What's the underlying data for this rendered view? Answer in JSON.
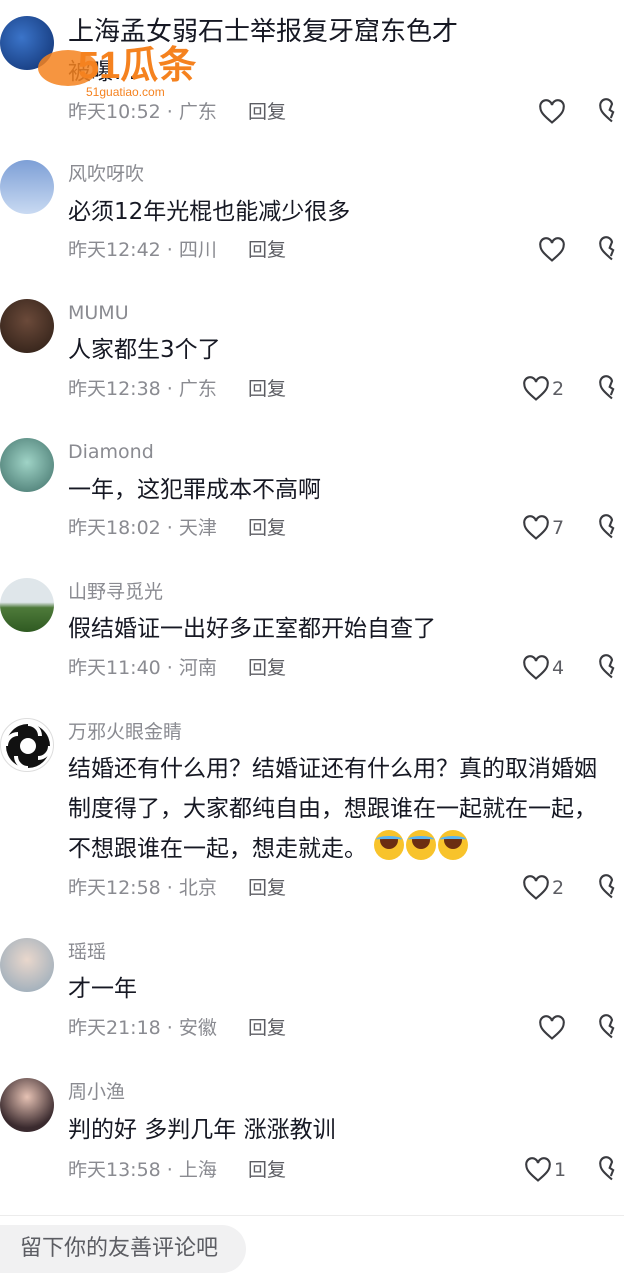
{
  "comments": [
    {
      "username": "",
      "text": "上海孟女弱石士举报复牙窟东色才",
      "text2": "被曝...",
      "meta": "昨天10:52 · 广东",
      "reply": "回复",
      "likes": "",
      "avatar": "blue-avatar"
    },
    {
      "username": "风吹呀吹",
      "text": "必须12年光棍也能减少很多",
      "meta": "昨天12:42 · 四川",
      "reply": "回复",
      "likes": "",
      "avatar": "sky-avatar"
    },
    {
      "username": "MUMU",
      "text": "人家都生3个了",
      "meta": "昨天12:38 · 广东",
      "reply": "回复",
      "likes": "2",
      "avatar": "dark-photo-avatar"
    },
    {
      "username": "Diamond",
      "text": "一年，这犯罪成本不高啊",
      "meta": "昨天18:02 · 天津",
      "reply": "回复",
      "likes": "7",
      "avatar": "anime-avatar"
    },
    {
      "username": "山野寻觅光",
      "text": "假结婚证一出好多正室都开始自查了",
      "meta": "昨天11:40 · 河南",
      "reply": "回复",
      "likes": "4",
      "avatar": "landscape-avatar"
    },
    {
      "username": "万邪火眼金睛",
      "text": "结婚还有什么用？结婚证还有什么用？真的取消婚姻",
      "text2": "制度得了，大家都纯自由，想跟谁在一起就在一起，",
      "text3": "不想跟谁在一起，想走就走。",
      "meta": "昨天12:58 · 北京",
      "reply": "回复",
      "likes": "2",
      "avatar": "swirl-avatar"
    },
    {
      "username": "瑶瑶",
      "text": "才一年",
      "meta": "昨天21:18 · 安徽",
      "reply": "回复",
      "likes": "",
      "avatar": "girl-avatar"
    },
    {
      "username": "周小渔",
      "text": "判的好 多判几年 涨涨教训",
      "meta": "昨天13:58 · 上海",
      "reply": "回复",
      "likes": "1",
      "avatar": "woman-avatar"
    }
  ],
  "emojis": [
    "laugh-cry-emoji",
    "laugh-cry-emoji",
    "laugh-cry-emoji"
  ],
  "input": {
    "placeholder": "留下你的友善评论吧"
  },
  "watermark": {
    "brand": "51瓜条",
    "url": "51guatiao.com"
  },
  "colors": {
    "text": "#161823",
    "secondary": "#8a8b91",
    "brand": "#f5821f"
  }
}
